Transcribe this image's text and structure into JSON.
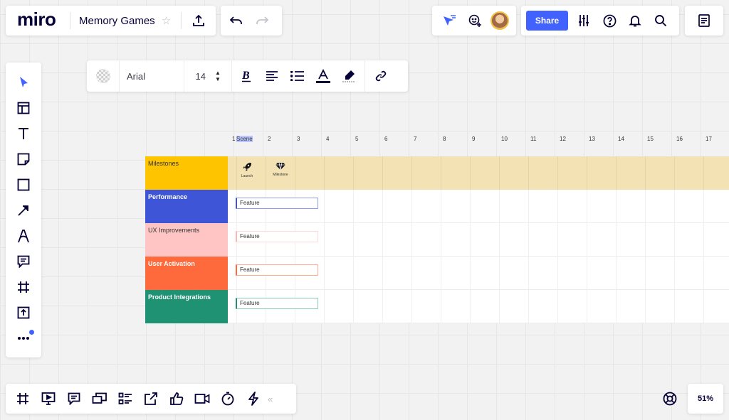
{
  "header": {
    "logo": "miro",
    "board_title": "Memory Games",
    "share_label": "Share"
  },
  "format_bar": {
    "font_name": "Arial",
    "font_size": "14"
  },
  "left_toolbar": {
    "tools": [
      "select-icon",
      "templates-icon",
      "text-icon",
      "sticky-note-icon",
      "shape-icon",
      "arrow-icon",
      "pen-icon",
      "comment-icon",
      "frame-icon",
      "upload-icon",
      "more-icon"
    ]
  },
  "timeline": {
    "columns": [
      "1",
      "Scene",
      "2",
      "3",
      "4",
      "5",
      "6",
      "7",
      "8",
      "9",
      "10",
      "11",
      "12",
      "13",
      "14",
      "15",
      "16",
      "17"
    ],
    "rows": [
      {
        "label": "Milestones",
        "color": "#ffc400"
      },
      {
        "label": "Performance",
        "color": "#3d55d6",
        "feature": "Feature",
        "accent": "#3d55d6"
      },
      {
        "label": "UX Improvements",
        "color": "#ffc4c4",
        "feature": "Feature",
        "accent": "#ffc4c4"
      },
      {
        "label": "User Activation",
        "color": "#ff6a3d",
        "feature": "Feature",
        "accent": "#ff6a3d"
      },
      {
        "label": "Product Integrations",
        "color": "#1e9272",
        "feature": "Feature",
        "accent": "#1e9272"
      }
    ],
    "milestones": [
      {
        "label": "Launch",
        "icon": "rocket-icon"
      },
      {
        "label": "Milestone",
        "icon": "diamond-icon"
      }
    ]
  },
  "bottom_bar": {
    "tools": [
      "frames-icon",
      "presentation-icon",
      "comments-icon",
      "screen-share-icon",
      "card-list-icon",
      "export-icon",
      "voting-icon",
      "video-call-icon",
      "timer-icon",
      "lightning-icon"
    ],
    "collapse": "«"
  },
  "zoom": "51%",
  "colors": {
    "accent": "#4262ff",
    "milestone_band": "#f2e2b4"
  }
}
